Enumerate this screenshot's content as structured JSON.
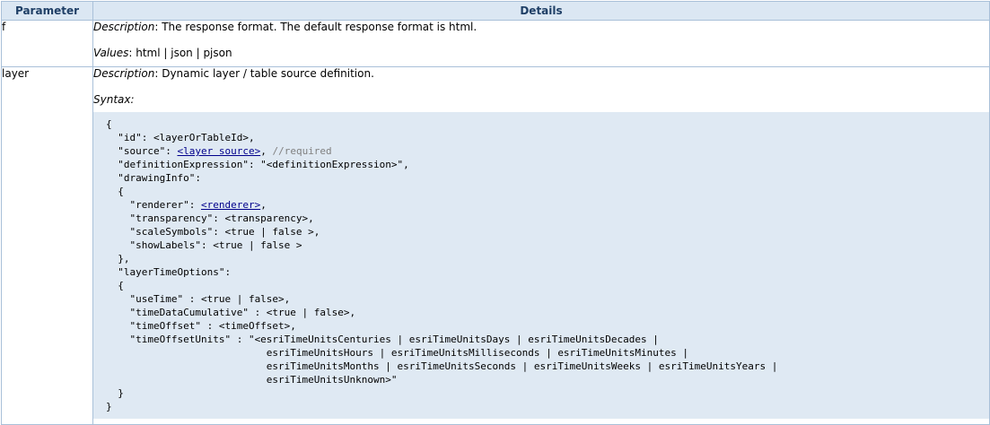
{
  "table": {
    "headers": [
      "Parameter",
      "Details"
    ]
  },
  "f": {
    "name": "f",
    "description_label": "Description",
    "description": ": The response format. The default response format is html.",
    "values_label": "Values",
    "values": ": html | json | pjson"
  },
  "layer": {
    "name": "layer",
    "description_label": "Description",
    "description": ": Dynamic layer / table source definition.",
    "syntax_label": "Syntax:",
    "code": {
      "l1": "{",
      "l2": "  \"id\": <layerOrTableId>,",
      "l3_pre": "  \"source\": ",
      "l3_link": "<layer source>",
      "l3_mid": ", ",
      "l3_comment": "//required",
      "l4": "  \"definitionExpression\": \"<definitionExpression>\",",
      "l5": "  \"drawingInfo\":",
      "l6": "  {",
      "l7_pre": "    \"renderer\": ",
      "l7_link": "<renderer>",
      "l7_post": ",",
      "l8": "    \"transparency\": <transparency>,",
      "l9": "    \"scaleSymbols\": <true | false >,",
      "l10": "    \"showLabels\": <true | false >",
      "l11": "  },",
      "l12": "  \"layerTimeOptions\":",
      "l13": "  {",
      "l14": "    \"useTime\" : <true | false>,",
      "l15": "    \"timeDataCumulative\" : <true | false>,",
      "l16": "    \"timeOffset\" : <timeOffset>,",
      "l17": "    \"timeOffsetUnits\" : \"<esriTimeUnitsCenturies | esriTimeUnitsDays | esriTimeUnitsDecades |",
      "l18": "                           esriTimeUnitsHours | esriTimeUnitsMilliseconds | esriTimeUnitsMinutes |",
      "l19": "                           esriTimeUnitsMonths | esriTimeUnitsSeconds | esriTimeUnitsWeeks | esriTimeUnitsYears |",
      "l20": "                           esriTimeUnitsUnknown>\"",
      "l21": "  }",
      "l22": "}"
    }
  }
}
